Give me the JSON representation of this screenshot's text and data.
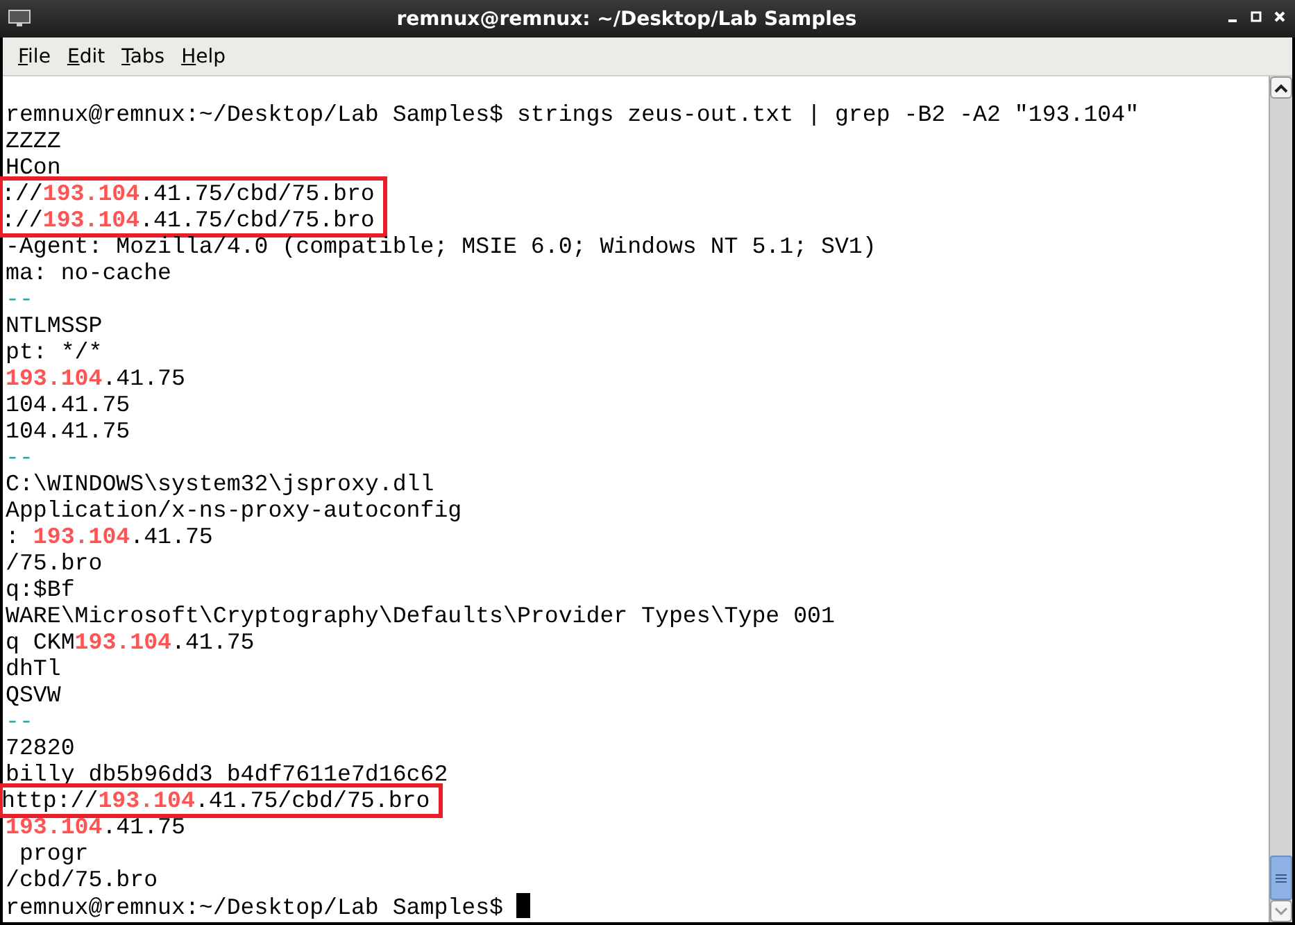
{
  "window": {
    "title": "remnux@remnux: ~/Desktop/Lab Samples"
  },
  "menu": [
    {
      "label": "File"
    },
    {
      "label": "Edit"
    },
    {
      "label": "Tabs"
    },
    {
      "label": "Help"
    }
  ],
  "terminal": {
    "lines": [
      {
        "boxed": false,
        "segments": [
          {
            "kind": "plain",
            "text": "remnux@remnux:~/Desktop/Lab Samples$ strings zeus-out.txt | grep -B2 -A2 \"193.104\""
          }
        ]
      },
      {
        "boxed": false,
        "segments": [
          {
            "kind": "plain",
            "text": "ZZZZ"
          }
        ]
      },
      {
        "boxed": false,
        "segments": [
          {
            "kind": "plain",
            "text": "HCon"
          }
        ]
      },
      {
        "boxed": true,
        "segments": [
          {
            "kind": "plain",
            "text": "://"
          },
          {
            "kind": "match",
            "text": "193.104"
          },
          {
            "kind": "plain",
            "text": ".41.75/cbd/75.bro"
          }
        ]
      },
      {
        "boxed": true,
        "segments": [
          {
            "kind": "plain",
            "text": "://"
          },
          {
            "kind": "match",
            "text": "193.104"
          },
          {
            "kind": "plain",
            "text": ".41.75/cbd/75.bro"
          }
        ]
      },
      {
        "boxed": false,
        "segments": [
          {
            "kind": "plain",
            "text": "-Agent: Mozilla/4.0 (compatible; MSIE 6.0; Windows NT 5.1; SV1)"
          }
        ]
      },
      {
        "boxed": false,
        "segments": [
          {
            "kind": "plain",
            "text": "ma: no-cache"
          }
        ]
      },
      {
        "boxed": false,
        "segments": [
          {
            "kind": "separator",
            "text": "--"
          }
        ]
      },
      {
        "boxed": false,
        "segments": [
          {
            "kind": "plain",
            "text": "NTLMSSP"
          }
        ]
      },
      {
        "boxed": false,
        "segments": [
          {
            "kind": "plain",
            "text": "pt: */*"
          }
        ]
      },
      {
        "boxed": false,
        "segments": [
          {
            "kind": "match",
            "text": "193.104"
          },
          {
            "kind": "plain",
            "text": ".41.75"
          }
        ]
      },
      {
        "boxed": false,
        "segments": [
          {
            "kind": "plain",
            "text": "104.41.75"
          }
        ]
      },
      {
        "boxed": false,
        "segments": [
          {
            "kind": "plain",
            "text": "104.41.75"
          }
        ]
      },
      {
        "boxed": false,
        "segments": [
          {
            "kind": "separator",
            "text": "--"
          }
        ]
      },
      {
        "boxed": false,
        "segments": [
          {
            "kind": "plain",
            "text": "C:\\WINDOWS\\system32\\jsproxy.dll"
          }
        ]
      },
      {
        "boxed": false,
        "segments": [
          {
            "kind": "plain",
            "text": "Application/x-ns-proxy-autoconfig"
          }
        ]
      },
      {
        "boxed": false,
        "segments": [
          {
            "kind": "plain",
            "text": ": "
          },
          {
            "kind": "match",
            "text": "193.104"
          },
          {
            "kind": "plain",
            "text": ".41.75"
          }
        ]
      },
      {
        "boxed": false,
        "segments": [
          {
            "kind": "plain",
            "text": "/75.bro"
          }
        ]
      },
      {
        "boxed": false,
        "segments": [
          {
            "kind": "plain",
            "text": "q:$Bf"
          }
        ]
      },
      {
        "boxed": false,
        "segments": [
          {
            "kind": "plain",
            "text": "WARE\\Microsoft\\Cryptography\\Defaults\\Provider Types\\Type 001"
          }
        ]
      },
      {
        "boxed": false,
        "segments": [
          {
            "kind": "plain",
            "text": "q CKM"
          },
          {
            "kind": "match",
            "text": "193.104"
          },
          {
            "kind": "plain",
            "text": ".41.75"
          }
        ]
      },
      {
        "boxed": false,
        "segments": [
          {
            "kind": "plain",
            "text": "dhTl"
          }
        ]
      },
      {
        "boxed": false,
        "segments": [
          {
            "kind": "plain",
            "text": "QSVW"
          }
        ]
      },
      {
        "boxed": false,
        "segments": [
          {
            "kind": "separator",
            "text": "--"
          }
        ]
      },
      {
        "boxed": false,
        "segments": [
          {
            "kind": "plain",
            "text": "72820"
          }
        ]
      },
      {
        "boxed": false,
        "segments": [
          {
            "kind": "plain",
            "text": "billy db5b96dd3 b4df7611e7d16c62"
          }
        ]
      },
      {
        "boxed": true,
        "segments": [
          {
            "kind": "plain",
            "text": "http://"
          },
          {
            "kind": "match",
            "text": "193.104"
          },
          {
            "kind": "plain",
            "text": ".41.75/cbd/75.bro"
          }
        ]
      },
      {
        "boxed": false,
        "segments": [
          {
            "kind": "match",
            "text": "193.104"
          },
          {
            "kind": "plain",
            "text": ".41.75"
          }
        ]
      },
      {
        "boxed": false,
        "segments": [
          {
            "kind": "plain",
            "text": " progr"
          }
        ]
      },
      {
        "boxed": false,
        "segments": [
          {
            "kind": "plain",
            "text": "/cbd/75.bro"
          }
        ]
      },
      {
        "boxed": false,
        "cursor": true,
        "segments": [
          {
            "kind": "plain",
            "text": "remnux@remnux:~/Desktop/Lab Samples$ "
          }
        ]
      }
    ]
  }
}
